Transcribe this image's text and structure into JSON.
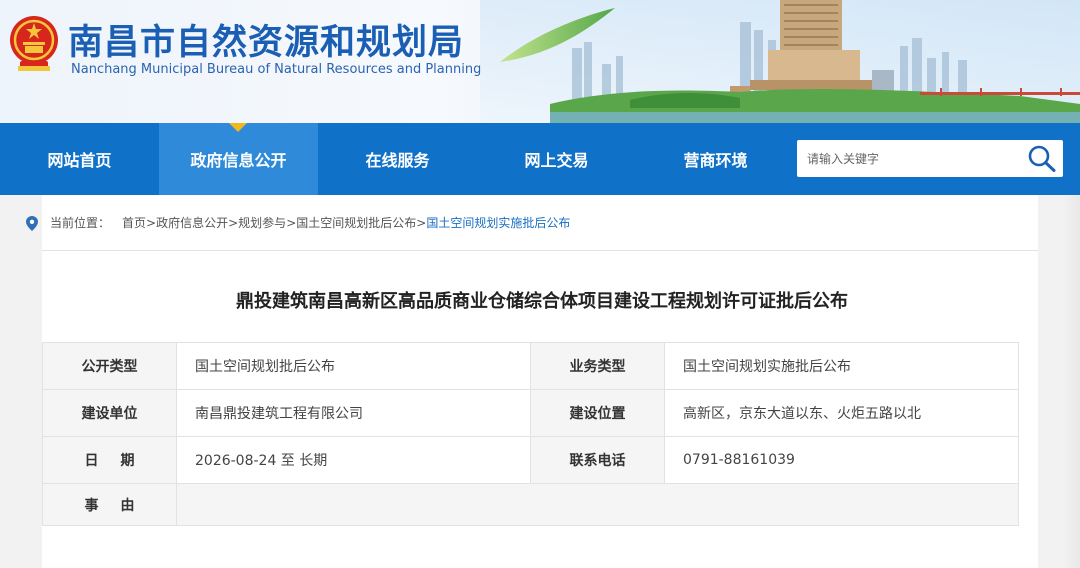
{
  "header": {
    "title": "南昌市自然资源和规划局",
    "subtitle": "Nanchang Municipal Bureau of Natural Resources and Planning",
    "emblem": "national-emblem-icon",
    "brand_color": "#1a5fb4"
  },
  "nav": {
    "items": [
      {
        "label": "网站首页",
        "active": false
      },
      {
        "label": "政府信息公开",
        "active": true
      },
      {
        "label": "在线服务",
        "active": false
      },
      {
        "label": "网上交易",
        "active": false
      },
      {
        "label": "营商环境",
        "active": false
      }
    ],
    "bg_color": "#0f71c8",
    "active_color": "#2f8bd9",
    "search_placeholder": "请输入关键字",
    "search_icon": "search-icon"
  },
  "breadcrumb": {
    "label": "当前位置：",
    "items": [
      "首页",
      "政府信息公开",
      "规划参与",
      "国土空间规划批后公布"
    ],
    "current": "国土空间规划实施批后公布",
    "separator": ">",
    "icon": "location-pin-icon"
  },
  "document": {
    "title": "鼎投建筑南昌高新区高品质商业仓储综合体项目建设工程规划许可证批后公布",
    "rows": [
      {
        "k1": "公开类型",
        "v1": "国土空间规划批后公布",
        "k2": "业务类型",
        "v2": "国土空间规划实施批后公布"
      },
      {
        "k1": "建设单位",
        "v1": "南昌鼎投建筑工程有限公司",
        "k2": "建设位置",
        "v2": "高新区，京东大道以东、火炬五路以北"
      },
      {
        "k1": "日期",
        "v1": "2026-08-24 至 长期",
        "k2": "联系电话",
        "v2": "0791-88161039"
      }
    ],
    "reason_label": "事由",
    "reason_value": ""
  }
}
